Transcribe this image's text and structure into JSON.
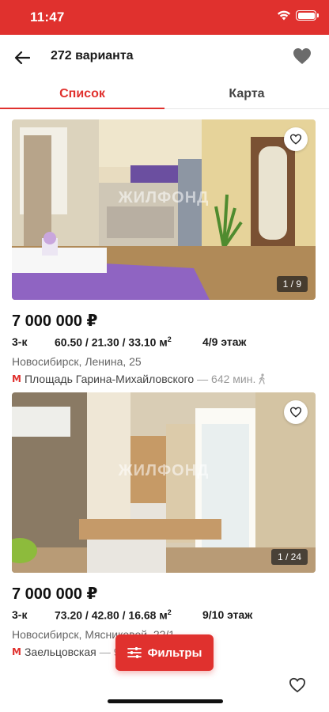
{
  "status_bar": {
    "time": "11:47",
    "accent_color": "#e0312e"
  },
  "nav": {
    "title": "272 варианта",
    "back_icon": "arrow-left-icon",
    "favorite_icon": "heart-icon"
  },
  "tabs": [
    {
      "label": "Список",
      "active": true
    },
    {
      "label": "Карта",
      "active": false
    }
  ],
  "listings": [
    {
      "watermark": "ЖИЛФОНД",
      "photo_counter": "1 / 9",
      "price": "7 000 000 ₽",
      "rooms": "3-к",
      "areas": "60.50 / 21.30 / 33.10 м",
      "area_sup": "2",
      "floor": "4/9 этаж",
      "address": "Новосибирск, Ленина, 25",
      "metro": "Площадь Гарина-Михайловского",
      "metro_distance": "— 642 мин."
    },
    {
      "watermark": "ЖИЛФОНД",
      "photo_counter": "1 / 24",
      "price": "7 000 000 ₽",
      "rooms": "3-к",
      "areas": "73.20 / 42.80 / 16.68 м",
      "area_sup": "2",
      "floor": "9/10 этаж",
      "address": "Новосибирск, Мясниковой, 22/1",
      "metro": "Заельцовская",
      "metro_distance": "— 9"
    }
  ],
  "filters_button": {
    "label": "Фильтры",
    "icon": "sliders-icon"
  }
}
